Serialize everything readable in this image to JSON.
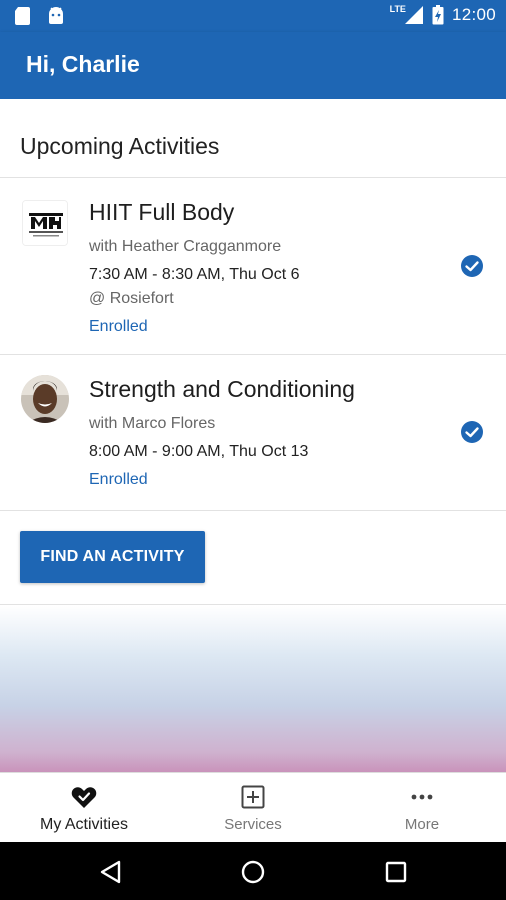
{
  "status_bar": {
    "time": "12:00",
    "network": "LTE",
    "icons": [
      "sd-card-icon",
      "android-icon",
      "signal-icon",
      "battery-icon"
    ]
  },
  "app_bar": {
    "title": "Hi, Charlie"
  },
  "section": {
    "title": "Upcoming Activities"
  },
  "activities": [
    {
      "title": "HIIT Full Body",
      "instructor": "with Heather Cragganmore",
      "time": "7:30 AM - 8:30 AM, Thu Oct 6",
      "location": "@ Rosiefort",
      "status": "Enrolled",
      "thumbnail": "gym-logo",
      "check_icon": "check-circle-icon"
    },
    {
      "title": "Strength and Conditioning",
      "instructor": "with Marco Flores",
      "time": "8:00 AM - 9:00 AM, Thu Oct 13",
      "status": "Enrolled",
      "thumbnail": "instructor-avatar",
      "check_icon": "check-circle-icon"
    }
  ],
  "find_button": {
    "label": "FIND AN ACTIVITY"
  },
  "bottom_nav": {
    "items": [
      {
        "label": "My Activities",
        "icon": "heart-check-icon",
        "active": true
      },
      {
        "label": "Services",
        "icon": "plus-square-icon",
        "active": false
      },
      {
        "label": "More",
        "icon": "more-dots-icon",
        "active": false
      }
    ]
  },
  "system_nav": {
    "icons": [
      "back-icon",
      "home-icon",
      "recents-icon"
    ]
  },
  "colors": {
    "primary": "#1e66b4",
    "text": "#222222",
    "muted": "#666666",
    "nav_bar": "#000000"
  }
}
